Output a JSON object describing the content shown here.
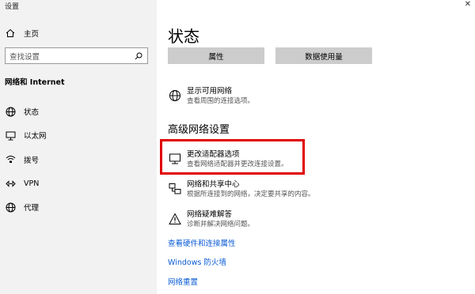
{
  "window": {
    "title": "设置"
  },
  "sidebar": {
    "home_label": "主页",
    "search_placeholder": "查找设置",
    "section_title": "网络和 Internet",
    "items": [
      {
        "label": "状态",
        "icon": "status-icon"
      },
      {
        "label": "以太网",
        "icon": "ethernet-icon"
      },
      {
        "label": "拨号",
        "icon": "dialup-icon"
      },
      {
        "label": "VPN",
        "icon": "vpn-icon"
      },
      {
        "label": "代理",
        "icon": "proxy-icon"
      }
    ]
  },
  "main": {
    "title": "状态",
    "buttons": {
      "properties": "属性",
      "data_usage": "数据使用量"
    },
    "show_networks": {
      "title": "显示可用网络",
      "desc": "查看周围的连接选项。"
    },
    "advanced_title": "高级网络设置",
    "options": [
      {
        "title": "更改适配器选项",
        "desc": "查看网络适配器并更改连接设置。",
        "icon": "adapter-icon"
      },
      {
        "title": "网络和共享中心",
        "desc": "根据所连接到的网络，决定要共享的内容。",
        "icon": "sharing-center-icon"
      },
      {
        "title": "网络疑难解答",
        "desc": "诊断并解决网络问题。",
        "icon": "warning-icon"
      }
    ],
    "links": [
      "查看硬件和连接属性",
      "Windows 防火墙",
      "网络重置"
    ]
  },
  "colors": {
    "highlight": "#e00000",
    "link": "#0a5bd6",
    "sidebar_bg": "#f2f2f2",
    "button_bg": "#cccccc"
  }
}
